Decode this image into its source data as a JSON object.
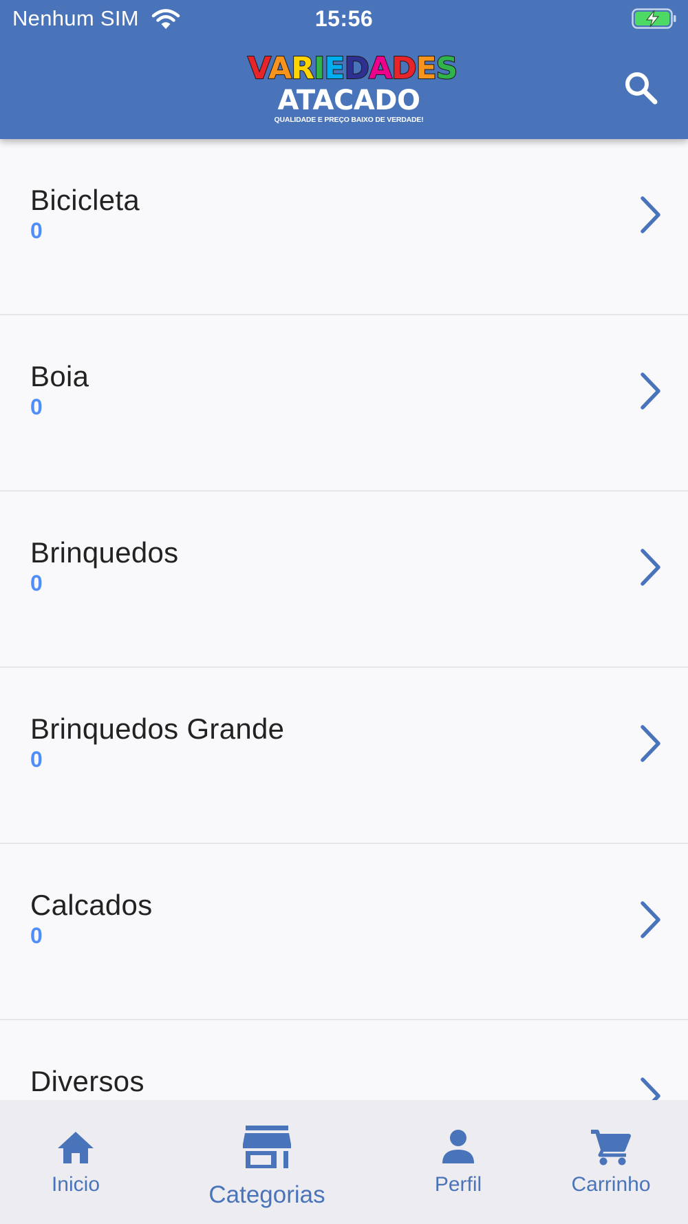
{
  "status_bar": {
    "carrier": "Nenhum SIM",
    "time": "15:56"
  },
  "header": {
    "logo": {
      "line1": "VARIEDADES",
      "line1_colors": [
        "#e8242b",
        "#f7941d",
        "#ffd400",
        "#2fb34a",
        "#00aeef",
        "#2e3192",
        "#ec008c",
        "#e8242b",
        "#f7941d",
        "#2fb34a"
      ],
      "line2": "ATACADO",
      "tagline": "QUALIDADE E PREÇO BAIXO DE VERDADE!"
    },
    "search_icon": "search-icon"
  },
  "categories": [
    {
      "name": "Bicicleta",
      "count": "0"
    },
    {
      "name": "Boia",
      "count": "0"
    },
    {
      "name": "Brinquedos",
      "count": "0"
    },
    {
      "name": "Brinquedos Grande",
      "count": "0"
    },
    {
      "name": "Calcados",
      "count": "0"
    },
    {
      "name": "Diversos",
      "count": ""
    }
  ],
  "tabbar": {
    "tabs": [
      {
        "label": "Inicio",
        "icon": "home-icon"
      },
      {
        "label": "Categorias",
        "icon": "store-icon",
        "active": true
      },
      {
        "label": "Perfil",
        "icon": "person-icon"
      },
      {
        "label": "Carrinho",
        "icon": "cart-icon"
      }
    ]
  },
  "colors": {
    "header_bg": "#4a74ba",
    "accent": "#4a74ba",
    "count": "#4f8ef7",
    "list_bg": "#f9f9fb",
    "tabbar_bg": "#ededf1",
    "battery_charge": "#4cd964"
  }
}
